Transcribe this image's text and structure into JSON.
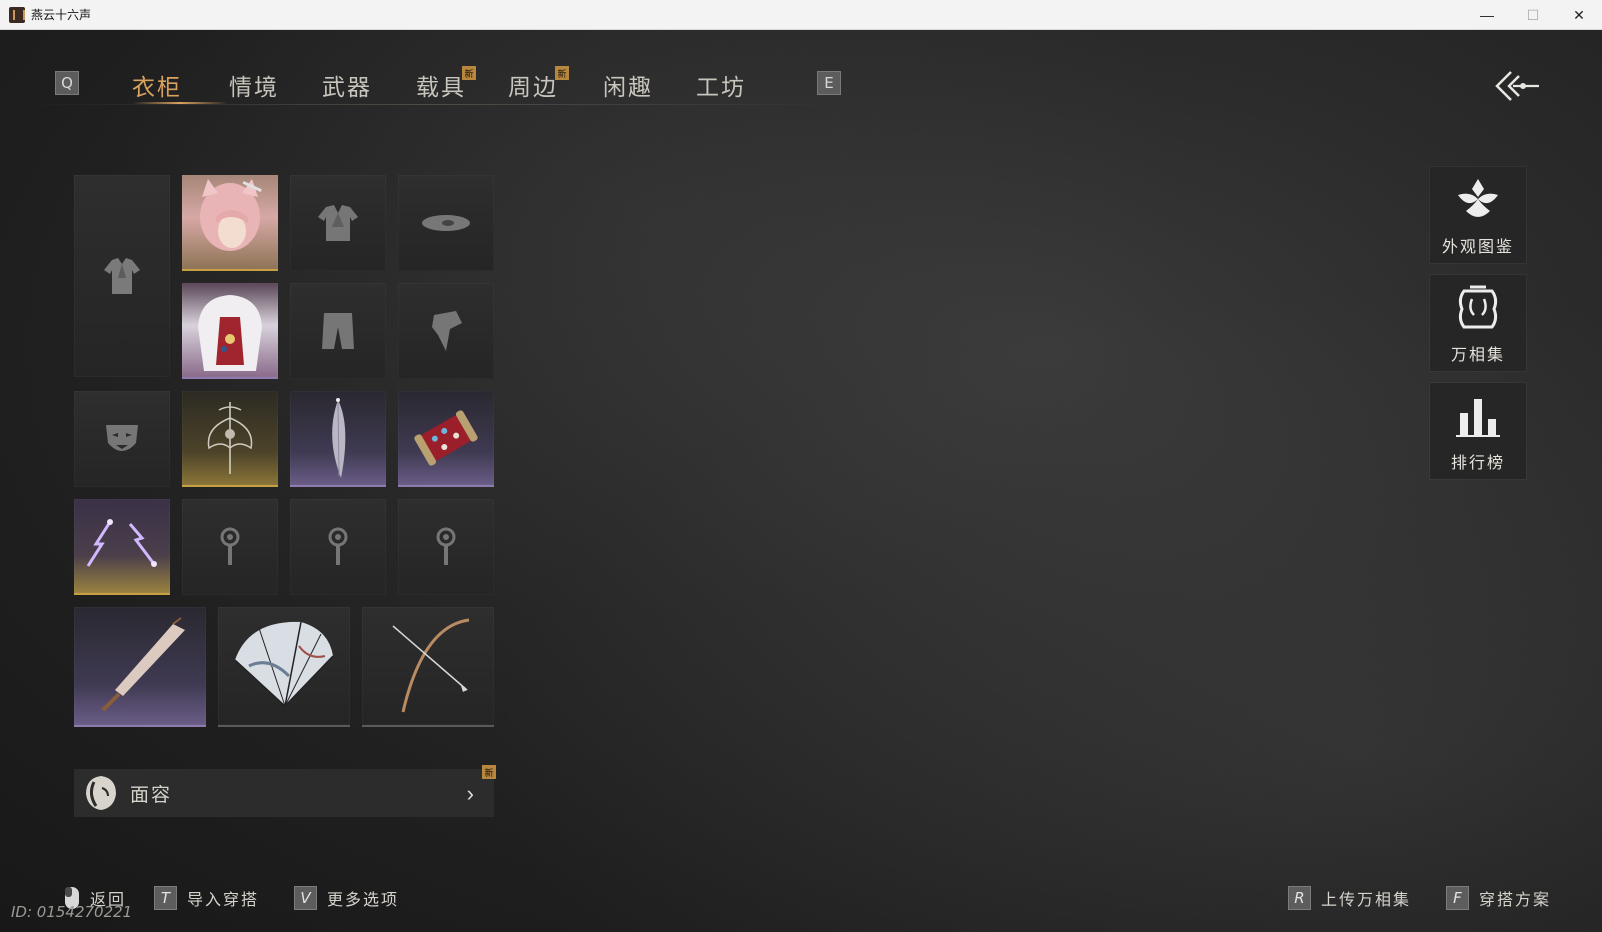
{
  "window": {
    "title": "燕云十六声",
    "min": "—",
    "max": "☐",
    "close": "✕"
  },
  "tabs": {
    "prev_key": "Q",
    "next_key": "E",
    "items": [
      {
        "label": "衣柜",
        "active": true,
        "new": false
      },
      {
        "label": "情境",
        "active": false,
        "new": false
      },
      {
        "label": "武器",
        "active": false,
        "new": false
      },
      {
        "label": "载具",
        "active": false,
        "new": true
      },
      {
        "label": "周边",
        "active": false,
        "new": true
      },
      {
        "label": "闲趣",
        "active": false,
        "new": false
      },
      {
        "label": "工坊",
        "active": false,
        "new": false
      }
    ],
    "new_badge": "新"
  },
  "face_bar": {
    "label": "面容",
    "new_badge": "新",
    "chevron": "›"
  },
  "side_buttons": [
    {
      "label": "外观图鉴",
      "icon": "flower-emblem-icon"
    },
    {
      "label": "万相集",
      "icon": "mirror-frame-icon"
    },
    {
      "label": "排行榜",
      "icon": "bar-ranking-icon"
    }
  ],
  "hints_left": [
    {
      "key": "",
      "label": "返回",
      "icon": "mouse-icon"
    },
    {
      "key": "T",
      "label": "导入穿搭"
    },
    {
      "key": "V",
      "label": "更多选项"
    }
  ],
  "hints_right": [
    {
      "key": "R",
      "label": "上传万相集"
    },
    {
      "key": "F",
      "label": "穿搭方案"
    }
  ],
  "player_id": "ID: 0154270221",
  "colors": {
    "accent_gold": "#d9a15e",
    "badge_gold": "#b8873f",
    "text_light": "#d6d3cc"
  }
}
